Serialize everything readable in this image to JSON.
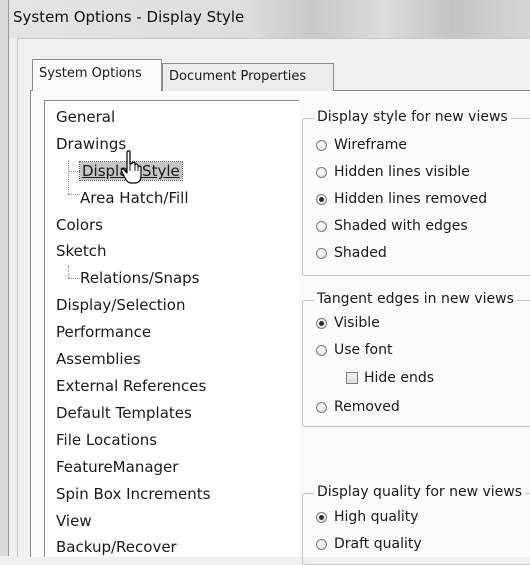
{
  "window": {
    "title": "System Options - Display Style"
  },
  "tabs": [
    {
      "label": "System Options",
      "active": true
    },
    {
      "label": "Document Properties",
      "active": false
    }
  ],
  "tree": {
    "items": [
      {
        "label": "General"
      },
      {
        "label": "Drawings"
      },
      {
        "label": "Display Style",
        "selected": true
      },
      {
        "label": "Area Hatch/Fill"
      },
      {
        "label": "Colors"
      },
      {
        "label": "Sketch"
      },
      {
        "label": "Relations/Snaps"
      },
      {
        "label": "Display/Selection"
      },
      {
        "label": "Performance"
      },
      {
        "label": "Assemblies"
      },
      {
        "label": "External References"
      },
      {
        "label": "Default Templates"
      },
      {
        "label": "File Locations"
      },
      {
        "label": "FeatureManager"
      },
      {
        "label": "Spin Box Increments"
      },
      {
        "label": "View"
      },
      {
        "label": "Backup/Recover"
      }
    ]
  },
  "display_style": {
    "legend": "Display style for new views",
    "options": [
      {
        "label": "Wireframe",
        "checked": false
      },
      {
        "label": "Hidden lines visible",
        "checked": false
      },
      {
        "label": "Hidden lines removed",
        "checked": true
      },
      {
        "label": "Shaded with edges",
        "checked": false
      },
      {
        "label": "Shaded",
        "checked": false
      }
    ]
  },
  "tangent_edges": {
    "legend": "Tangent edges in new views",
    "visible": "Visible",
    "use_font": "Use font",
    "hide_ends": "Hide ends",
    "removed": "Removed",
    "selected": "Visible"
  },
  "display_quality": {
    "legend": "Display quality for new views",
    "high": "High quality",
    "draft": "Draft quality",
    "selected": "High quality"
  },
  "icons": {
    "cursor": "hand-pointer-icon"
  }
}
